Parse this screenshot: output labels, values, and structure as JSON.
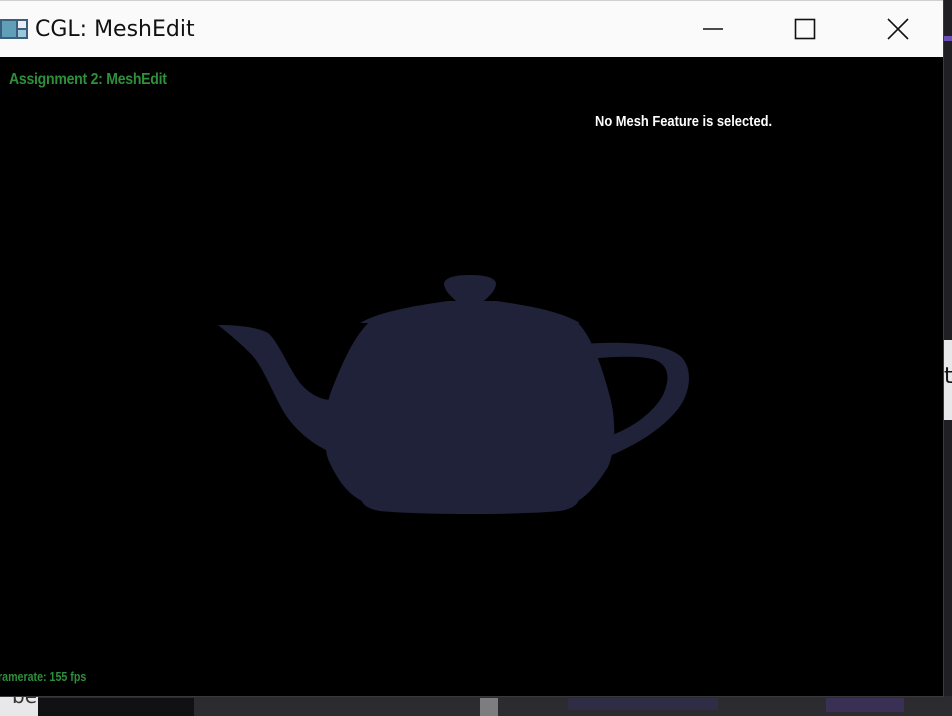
{
  "window": {
    "title": "CGL: MeshEdit",
    "controls": {
      "minimize_icon": "minimize-icon",
      "maximize_icon": "maximize-icon",
      "close_icon": "close-icon"
    }
  },
  "viewport": {
    "assignment_title": "Assignment 2: MeshEdit",
    "mesh_status": "No Mesh Feature is selected.",
    "framerate": "ramerate: 155 fps",
    "background_color": "#000000",
    "mesh_color": "#1f2238",
    "overlay_text_color": "#2f8f3a"
  },
  "desktop": {
    "bottom_left_text": "be",
    "right_text": "t"
  }
}
